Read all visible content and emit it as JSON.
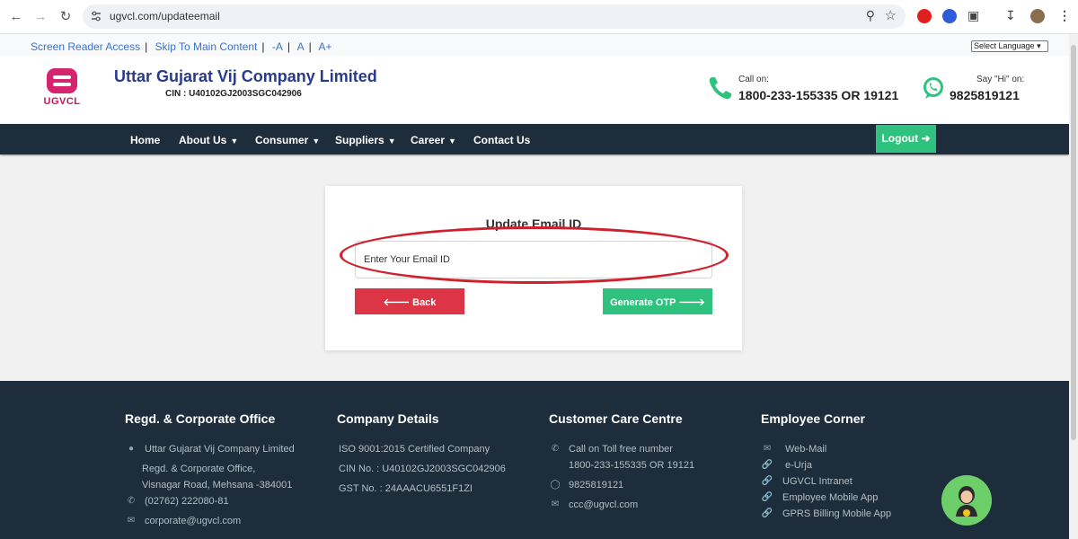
{
  "browser": {
    "url": "ugvcl.com/updateemail"
  },
  "access_bar": {
    "screen_reader": "Screen Reader Access",
    "skip_main": "Skip To Main Content",
    "font_minus": "-A",
    "font_normal": "A",
    "font_plus": "A+",
    "language": "Select Language"
  },
  "header": {
    "logo_text": "UGVCL",
    "company_name": "Uttar Gujarat Vij Company Limited",
    "cin": "CIN : U40102GJ2003SGC042906",
    "call_label": "Call on:",
    "call_number": "1800-233-155335 OR 19121",
    "wa_label": "Say \"Hi\" on:",
    "wa_number": "9825819121"
  },
  "nav": {
    "items": [
      "Home",
      "About Us",
      "Consumer",
      "Suppliers",
      "Career",
      "Contact Us"
    ],
    "logout": "Logout"
  },
  "form": {
    "title": "Update Email ID",
    "email_placeholder": "Enter Your Email ID",
    "back_label": "Back",
    "otp_label": "Generate OTP"
  },
  "footer": {
    "col1": {
      "title": "Regd. & Corporate Office",
      "company": "Uttar Gujarat Vij Company Limited",
      "addr1": "Regd. & Corporate Office,",
      "addr2": "Visnagar Road, Mehsana -384001",
      "phone": "(02762) 222080-81",
      "email": "corporate@ugvcl.com"
    },
    "col2": {
      "title": "Company Details",
      "iso": "ISO 9001:2015 Certified Company",
      "cin": "CIN No. : U40102GJ2003SGC042906",
      "gst": "GST No. : 24AAACU6551F1ZI"
    },
    "col3": {
      "title": "Customer Care Centre",
      "toll_label": "Call on Toll free number",
      "toll_number": "1800-233-155335 OR 19121",
      "whatsapp": "9825819121",
      "email": "ccc@ugvcl.com"
    },
    "col4": {
      "title": "Employee Corner",
      "links": [
        "Web-Mail",
        "e-Urja",
        "UGVCL Intranet",
        "Employee Mobile App",
        "GPRS Billing Mobile App"
      ]
    }
  },
  "colors": {
    "navbar_bg": "#1e2d3b",
    "accent_green": "#2ec27e",
    "back_red": "#dc3545",
    "highlight_red": "#d0202c",
    "brand_pink": "#d6246e"
  }
}
